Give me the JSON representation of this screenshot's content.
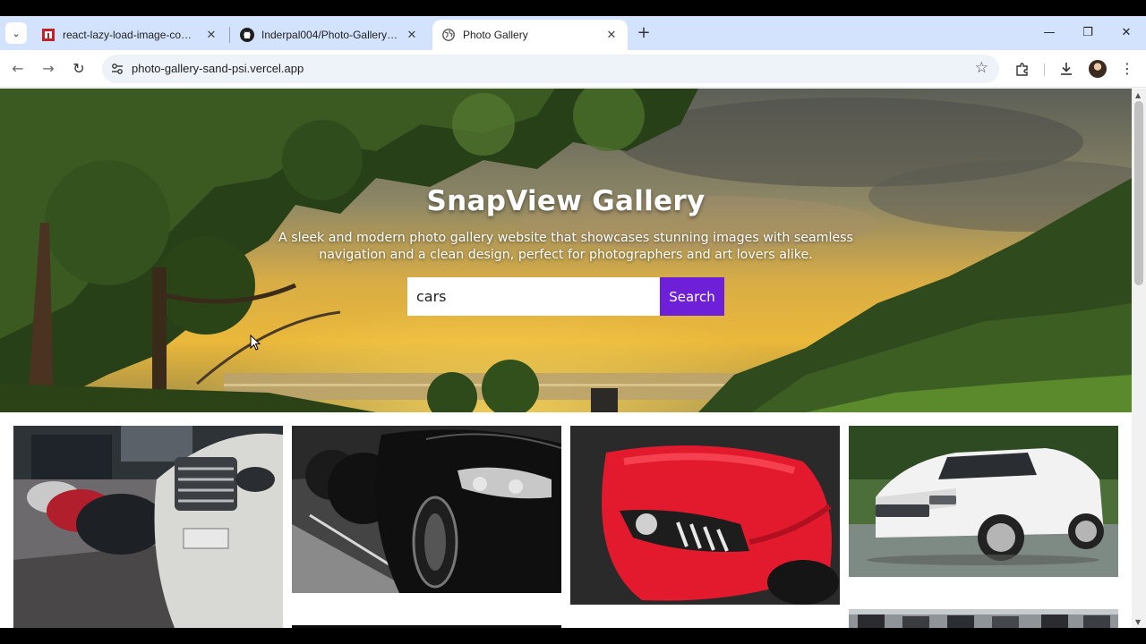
{
  "browser": {
    "tabs": [
      {
        "title": "react-lazy-load-image-compo",
        "icon": "npm-icon"
      },
      {
        "title": "Inderpal004/Photo-Gallery: Mi",
        "icon": "github-icon"
      },
      {
        "title": "Photo Gallery",
        "icon": "globe-icon",
        "active": true
      }
    ],
    "url": "photo-gallery-sand-psi.vercel.app"
  },
  "hero": {
    "title": "SnapView Gallery",
    "subtitle_line1": "A sleek and modern photo gallery website that showcases stunning images with seamless",
    "subtitle_line2": "navigation and a clean design, perfect for photographers and art lovers alike."
  },
  "search": {
    "value": "cars",
    "button_label": "Search"
  },
  "colors": {
    "accent": "#6e1fd8",
    "tabstrip": "#d3e3fd"
  }
}
